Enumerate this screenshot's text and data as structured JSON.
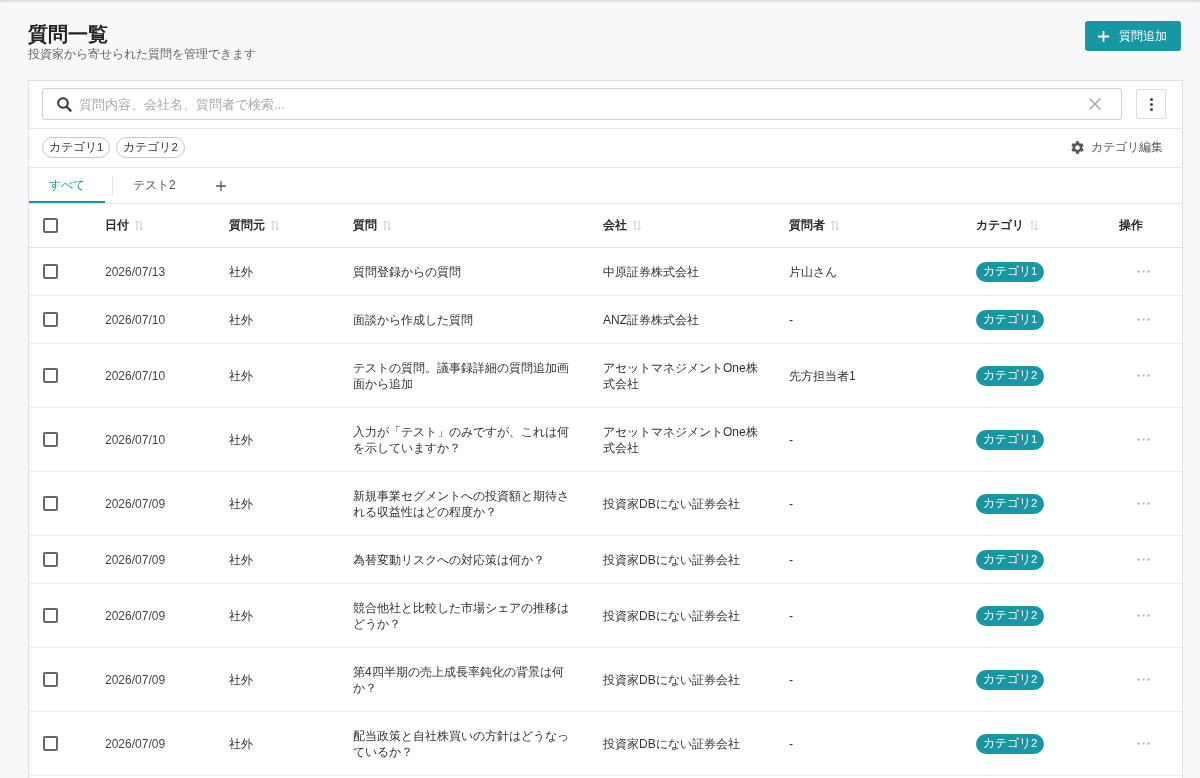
{
  "header": {
    "title": "質問一覧",
    "subtitle": "投資家から寄せられた質問を管理できます",
    "add_button": {
      "label": "質問追加"
    }
  },
  "search": {
    "placeholder": "質問内容、会社名、質問者で検索..."
  },
  "category_chips": [
    {
      "label": "カテゴリ1",
      "selected": false
    },
    {
      "label": "カテゴリ2",
      "selected": false
    }
  ],
  "category_edit": {
    "label": "カテゴリ編集"
  },
  "tabs": [
    {
      "label": "すべて",
      "selected": true
    },
    {
      "label": "テスト2",
      "selected": false
    }
  ],
  "table": {
    "select_all": {
      "checked": false
    },
    "columns": [
      {
        "label": "日付",
        "sortable": true
      },
      {
        "label": "質問元",
        "sortable": true
      },
      {
        "label": "質問",
        "sortable": true
      },
      {
        "label": "会社",
        "sortable": true
      },
      {
        "label": "質問者",
        "sortable": true
      },
      {
        "label": "カテゴリ",
        "sortable": true
      },
      {
        "label": "操作",
        "sortable": false
      }
    ],
    "rows": [
      {
        "checked": false,
        "date": "2026/07/13",
        "source": "社外",
        "question": "質問登録からの質問",
        "company": "中原証券株式会社",
        "asker": "片山さん",
        "category": "カテゴリ1"
      },
      {
        "checked": false,
        "date": "2026/07/10",
        "source": "社外",
        "question": "面談から作成した質問",
        "company": "ANZ証券株式会社",
        "asker": "-",
        "category": "カテゴリ1"
      },
      {
        "checked": false,
        "date": "2026/07/10",
        "source": "社外",
        "question": "テストの質問。議事録詳細の質問追加画面から追加",
        "company": "アセットマネジメントOne株式会社",
        "asker": "先方担当者1",
        "category": "カテゴリ2"
      },
      {
        "checked": false,
        "date": "2026/07/10",
        "source": "社外",
        "question": "入力が「テスト」のみですが、これは何を示していますか？",
        "company": "アセットマネジメントOne株式会社",
        "asker": "-",
        "category": "カテゴリ1"
      },
      {
        "checked": false,
        "date": "2026/07/09",
        "source": "社外",
        "question": "新規事業セグメントへの投資額と期待される収益性はどの程度か？",
        "company": "投資家DBにない証券会社",
        "asker": "-",
        "category": "カテゴリ2"
      },
      {
        "checked": false,
        "date": "2026/07/09",
        "source": "社外",
        "question": "為替変動リスクへの対応策は何か？",
        "company": "投資家DBにない証券会社",
        "asker": "-",
        "category": "カテゴリ2"
      },
      {
        "checked": false,
        "date": "2026/07/09",
        "source": "社外",
        "question": "競合他社と比較した市場シェアの推移はどうか？",
        "company": "投資家DBにない証券会社",
        "asker": "-",
        "category": "カテゴリ2"
      },
      {
        "checked": false,
        "date": "2026/07/09",
        "source": "社外",
        "question": "第4四半期の売上成長率鈍化の背景は何か？",
        "company": "投資家DBにない証券会社",
        "asker": "-",
        "category": "カテゴリ2"
      },
      {
        "checked": false,
        "date": "2026/07/09",
        "source": "社外",
        "question": "配当政策と自社株買いの方針はどうなっているか？",
        "company": "投資家DBにない証券会社",
        "asker": "-",
        "category": "カテゴリ2"
      }
    ]
  }
}
